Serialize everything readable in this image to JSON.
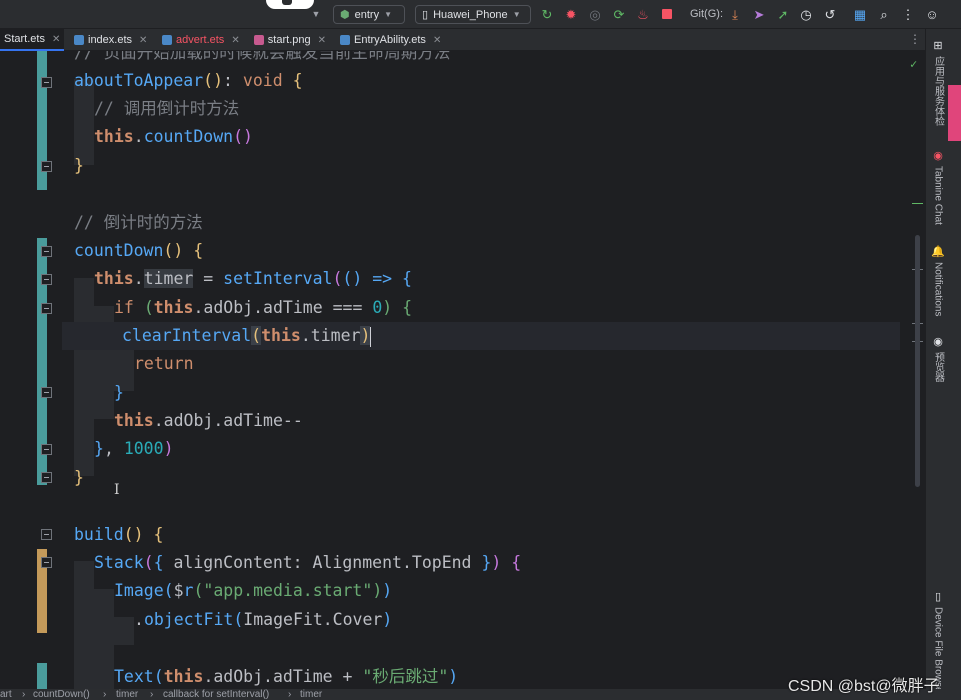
{
  "toolbar": {
    "module_selector": "entry",
    "device_selector": "Huawei_Phone",
    "git_label": "Git(G):",
    "icons": [
      "chevron-down-icon",
      "refresh-icon",
      "debug-bug-icon",
      "attach-icon",
      "rerun-icon",
      "profile-icon",
      "stop-icon",
      "git-update-icon",
      "git-commit-icon",
      "git-push-icon",
      "git-history-icon",
      "rollback-icon",
      "layout-icon",
      "search-icon",
      "more-icon",
      "account-icon"
    ]
  },
  "tabs": [
    {
      "label": "Start.ets",
      "active": true,
      "error": false
    },
    {
      "label": "index.ets",
      "active": false,
      "error": false
    },
    {
      "label": "advert.ets",
      "active": false,
      "error": true
    },
    {
      "label": "start.png",
      "active": false,
      "error": false
    },
    {
      "label": "EntryAbility.ets",
      "active": false,
      "error": false
    }
  ],
  "colors": {
    "keyword": "#cf8e6d",
    "function": "#56a8f5",
    "string": "#6aab73",
    "number": "#2aacb8",
    "comment": "#7a7e85",
    "vcs_modified": "#4a9c9c",
    "vcs_added": "#c49a5a"
  },
  "code": {
    "lines": [
      "// 页面开始加载的时候就会触发当前生命周期方法",
      "aboutToAppear(): void {",
      "// 调用倒计时方法",
      "this.countDown()",
      "}",
      "",
      "// 倒计时的方法",
      "countDown() {",
      "this.timer = setInterval(() => {",
      "if (this.adObj.adTime === 0) {",
      "clearInterval(this.timer)",
      "return",
      "}",
      "this.adObj.adTime--",
      "}, 1000)",
      "}",
      "",
      "build() {",
      "Stack({ alignContent: Alignment.TopEnd }) {",
      "Image($r(\"app.media.start\"))",
      ".objectFit(ImageFit.Cover)",
      "",
      "Text(this.adObj.adTime + \"秒后跳过\")"
    ]
  },
  "side_panel": [
    {
      "label": "应用与服务体检",
      "icon": "health-check-icon"
    },
    {
      "label": "Tabnine Chat",
      "icon": "tabnine-icon"
    },
    {
      "label": "Notifications",
      "icon": "bell-icon"
    },
    {
      "label": "预览器",
      "icon": "eye-icon"
    },
    {
      "label": "Device File Browser",
      "icon": "device-icon"
    }
  ],
  "breadcrumb": [
    "art",
    "countDown()",
    "timer",
    "callback for setInterval()",
    "timer"
  ],
  "watermark": "CSDN @bst@微胖子"
}
